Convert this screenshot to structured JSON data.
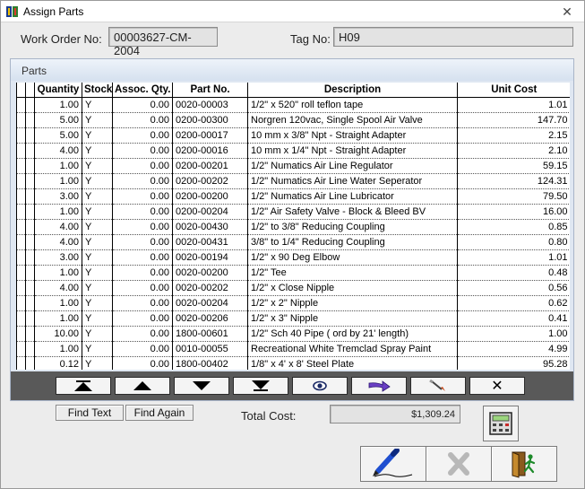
{
  "window": {
    "title": "Assign Parts",
    "close_glyph": "✕"
  },
  "header": {
    "work_order_label": "Work Order No:",
    "work_order_value": "00003627-CM-2004",
    "tag_label": "Tag No:",
    "tag_value": "H09"
  },
  "parts": {
    "caption": "Parts",
    "columns": [
      "Quantity",
      "Stock",
      "Assoc. Qty.",
      "Part No.",
      "Description",
      "Unit Cost"
    ],
    "rows": [
      {
        "quantity": "1.00",
        "stock": "Y",
        "assoc_qty": "0.00",
        "part_no": "0020-00003",
        "description": "1/2\" x 520\" roll teflon tape",
        "unit_cost": "1.01"
      },
      {
        "quantity": "5.00",
        "stock": "Y",
        "assoc_qty": "0.00",
        "part_no": "0200-00300",
        "description": "Norgren 120vac, Single Spool Air Valve",
        "unit_cost": "147.70"
      },
      {
        "quantity": "5.00",
        "stock": "Y",
        "assoc_qty": "0.00",
        "part_no": "0200-00017",
        "description": "10 mm x 3/8\" Npt - Straight Adapter",
        "unit_cost": "2.15"
      },
      {
        "quantity": "4.00",
        "stock": "Y",
        "assoc_qty": "0.00",
        "part_no": "0200-00016",
        "description": "10 mm x 1/4\" Npt - Straight Adapter",
        "unit_cost": "2.10"
      },
      {
        "quantity": "1.00",
        "stock": "Y",
        "assoc_qty": "0.00",
        "part_no": "0200-00201",
        "description": "1/2\" Numatics Air Line Regulator",
        "unit_cost": "59.15"
      },
      {
        "quantity": "1.00",
        "stock": "Y",
        "assoc_qty": "0.00",
        "part_no": "0200-00202",
        "description": "1/2\" Numatics Air Line Water Seperator",
        "unit_cost": "124.31"
      },
      {
        "quantity": "3.00",
        "stock": "Y",
        "assoc_qty": "0.00",
        "part_no": "0200-00200",
        "description": "1/2\" Numatics Air Line Lubricator",
        "unit_cost": "79.50"
      },
      {
        "quantity": "1.00",
        "stock": "Y",
        "assoc_qty": "0.00",
        "part_no": "0200-00204",
        "description": "1/2\" Air Safety Valve - Block & Bleed BV",
        "unit_cost": "16.00"
      },
      {
        "quantity": "4.00",
        "stock": "Y",
        "assoc_qty": "0.00",
        "part_no": "0020-00430",
        "description": "1/2\" to 3/8\" Reducing Coupling",
        "unit_cost": "0.85"
      },
      {
        "quantity": "4.00",
        "stock": "Y",
        "assoc_qty": "0.00",
        "part_no": "0020-00431",
        "description": "3/8\" to 1/4\" Reducing Coupling",
        "unit_cost": "0.80"
      },
      {
        "quantity": "3.00",
        "stock": "Y",
        "assoc_qty": "0.00",
        "part_no": "0020-00194",
        "description": "1/2\" x 90 Deg Elbow",
        "unit_cost": "1.01"
      },
      {
        "quantity": "1.00",
        "stock": "Y",
        "assoc_qty": "0.00",
        "part_no": "0020-00200",
        "description": "1/2\" Tee",
        "unit_cost": "0.48"
      },
      {
        "quantity": "4.00",
        "stock": "Y",
        "assoc_qty": "0.00",
        "part_no": "0020-00202",
        "description": "1/2\" x Close Nipple",
        "unit_cost": "0.56"
      },
      {
        "quantity": "1.00",
        "stock": "Y",
        "assoc_qty": "0.00",
        "part_no": "0020-00204",
        "description": "1/2\" x 2\" Nipple",
        "unit_cost": "0.62"
      },
      {
        "quantity": "1.00",
        "stock": "Y",
        "assoc_qty": "0.00",
        "part_no": "0020-00206",
        "description": "1/2\" x 3\" Nipple",
        "unit_cost": "0.41"
      },
      {
        "quantity": "10.00",
        "stock": "Y",
        "assoc_qty": "0.00",
        "part_no": "1800-00601",
        "description": "1/2\" Sch 40 Pipe ( ord by 21' length)",
        "unit_cost": "1.00"
      },
      {
        "quantity": "1.00",
        "stock": "Y",
        "assoc_qty": "0.00",
        "part_no": "0010-00055",
        "description": "Recreational White Tremclad Spray Paint",
        "unit_cost": "4.99"
      },
      {
        "quantity": "0.12",
        "stock": "Y",
        "assoc_qty": "0.00",
        "part_no": "1800-00402",
        "description": "1/8\" x 4' x 8' Steel Plate",
        "unit_cost": "95.28"
      }
    ]
  },
  "navigator": {
    "buttons": [
      "first-record-icon",
      "previous-record-icon",
      "next-record-icon",
      "last-record-icon",
      "view-icon",
      "go-to-icon",
      "edit-record-icon",
      "delete-record-icon"
    ],
    "delete_glyph": "✕"
  },
  "search": {
    "find_text_label": "Find Text",
    "find_again_label": "Find Again"
  },
  "totals": {
    "total_cost_label": "Total Cost:",
    "total_cost_value": "$1,309.24"
  },
  "colors": {
    "nav_bar": "#595959",
    "caption_bg": "#dfe7f2",
    "pen_blue": "#1f4fd0",
    "arrow_purple": "#6a3fc4"
  }
}
